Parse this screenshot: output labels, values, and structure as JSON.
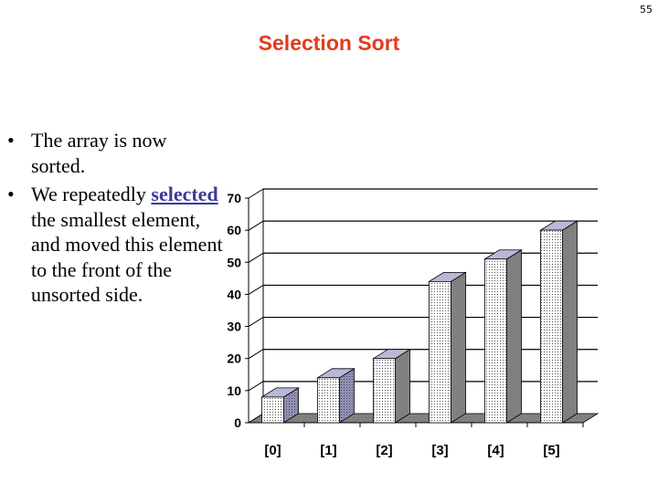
{
  "page_number": "55",
  "title": "Selection Sort",
  "bullets": [
    {
      "parts": [
        {
          "text": "The array is now sorted.",
          "link": false
        }
      ]
    },
    {
      "parts": [
        {
          "text": "We repeatedly ",
          "link": false
        },
        {
          "text": "selected",
          "link": true
        },
        {
          "text": " the smallest element, and moved this element to the front of the unsorted side.",
          "link": false
        }
      ]
    }
  ],
  "colors": {
    "title": "#e03c1c",
    "link": "#3b3b9c",
    "bar_top": "#b8b8d8",
    "bar_side": "#808080",
    "floor": "#808080"
  },
  "chart_data": {
    "type": "bar",
    "style": "3d-column",
    "title": "",
    "xlabel": "",
    "ylabel": "",
    "categories": [
      "[0]",
      "[1]",
      "[2]",
      "[3]",
      "[4]",
      "[5]"
    ],
    "values": [
      8,
      14,
      20,
      44,
      51,
      60
    ],
    "ylim": [
      0,
      70
    ],
    "yticks": [
      0,
      10,
      20,
      30,
      40,
      50,
      60,
      70
    ],
    "grid": true,
    "legend": "none"
  }
}
